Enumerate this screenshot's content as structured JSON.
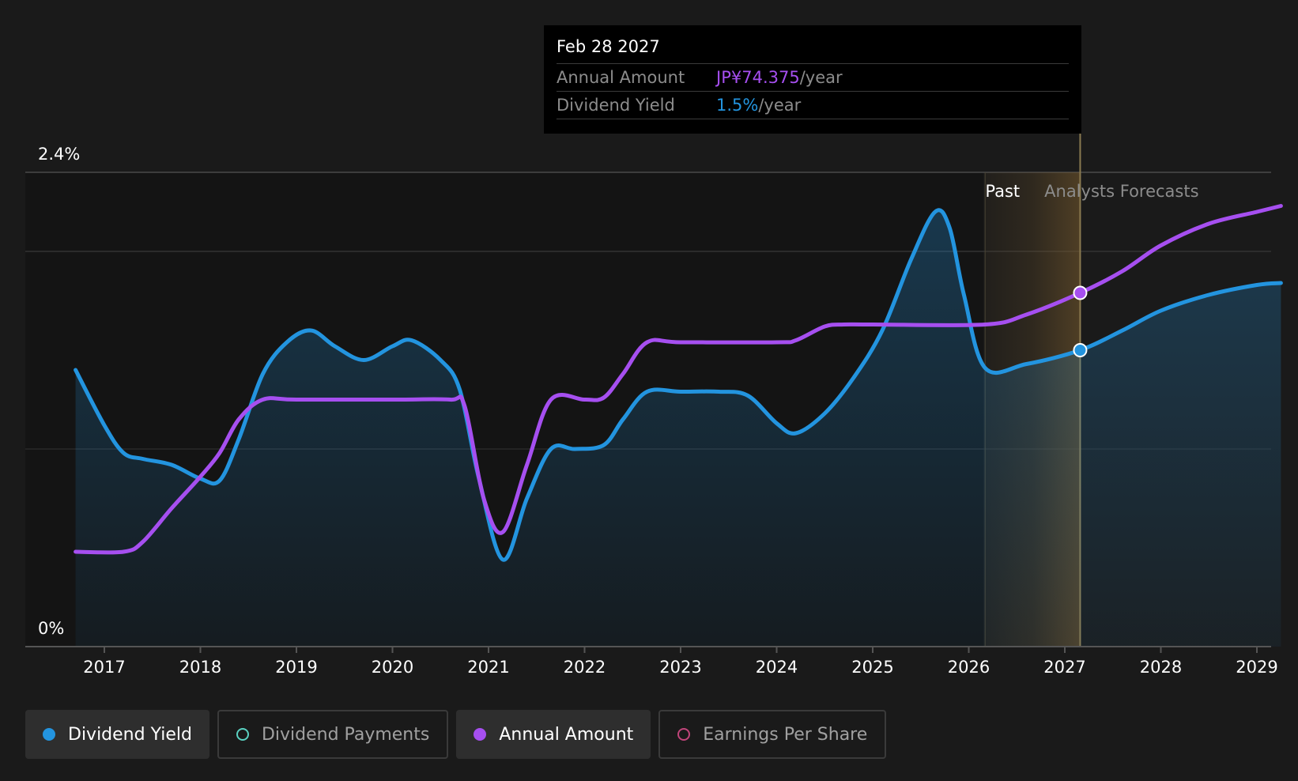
{
  "tooltip": {
    "date": "Feb 28 2027",
    "annual_label": "Annual Amount",
    "annual_value": "JP¥74.375",
    "annual_unit": "/year",
    "yield_label": "Dividend Yield",
    "yield_value": "1.5%",
    "yield_unit": "/year"
  },
  "colors": {
    "background": "#1a1a1a",
    "dividend_yield": "#2394df",
    "annual_amount": "#a64ff0",
    "dividend_payments": "#5ad1c1",
    "earnings_per_share": "#c0457a",
    "forecast_band": "#7a5c2e"
  },
  "legend": [
    {
      "label": "Dividend Yield",
      "icon": "filled-circle",
      "color": "#2394df",
      "active": true
    },
    {
      "label": "Dividend Payments",
      "icon": "hollow-circle",
      "color": "#5ad1c1",
      "active": false
    },
    {
      "label": "Annual Amount",
      "icon": "filled-circle",
      "color": "#a64ff0",
      "active": true
    },
    {
      "label": "Earnings Per Share",
      "icon": "hollow-circle",
      "color": "#c0457a",
      "active": false
    }
  ],
  "chart_data": {
    "type": "line",
    "y_tick_labels": [
      "2.4%",
      "0%"
    ],
    "ylim": [
      0,
      2.4
    ],
    "xlim": [
      2016.25,
      2029.25
    ],
    "x_tick_labels": [
      "2017",
      "2018",
      "2019",
      "2020",
      "2021",
      "2022",
      "2023",
      "2024",
      "2025",
      "2026",
      "2027",
      "2028",
      "2029"
    ],
    "past_label": "Past",
    "forecast_label": "Analysts Forecasts",
    "past_end": 2026.17,
    "hover_x": 2027.16,
    "grid": true,
    "series": [
      {
        "name": "Dividend Yield",
        "color": "#2394df",
        "fill": true,
        "points": [
          [
            2016.7,
            1.4
          ],
          [
            2017.0,
            1.12
          ],
          [
            2017.2,
            0.98
          ],
          [
            2017.4,
            0.95
          ],
          [
            2017.7,
            0.92
          ],
          [
            2018.0,
            0.85
          ],
          [
            2018.2,
            0.84
          ],
          [
            2018.4,
            1.05
          ],
          [
            2018.65,
            1.38
          ],
          [
            2018.9,
            1.54
          ],
          [
            2019.15,
            1.6
          ],
          [
            2019.4,
            1.52
          ],
          [
            2019.7,
            1.45
          ],
          [
            2020.0,
            1.52
          ],
          [
            2020.2,
            1.55
          ],
          [
            2020.5,
            1.45
          ],
          [
            2020.7,
            1.3
          ],
          [
            2020.9,
            0.85
          ],
          [
            2021.15,
            0.44
          ],
          [
            2021.4,
            0.75
          ],
          [
            2021.65,
            1.0
          ],
          [
            2021.9,
            1.0
          ],
          [
            2022.2,
            1.02
          ],
          [
            2022.4,
            1.15
          ],
          [
            2022.65,
            1.29
          ],
          [
            2023.0,
            1.29
          ],
          [
            2023.4,
            1.29
          ],
          [
            2023.7,
            1.27
          ],
          [
            2024.0,
            1.13
          ],
          [
            2024.2,
            1.08
          ],
          [
            2024.5,
            1.18
          ],
          [
            2024.8,
            1.36
          ],
          [
            2025.1,
            1.6
          ],
          [
            2025.4,
            1.96
          ],
          [
            2025.65,
            2.2
          ],
          [
            2025.8,
            2.12
          ],
          [
            2025.95,
            1.78
          ],
          [
            2026.17,
            1.41
          ],
          [
            2026.6,
            1.43
          ],
          [
            2027.16,
            1.5
          ],
          [
            2027.6,
            1.6
          ],
          [
            2028.0,
            1.7
          ],
          [
            2028.5,
            1.78
          ],
          [
            2029.0,
            1.83
          ],
          [
            2029.25,
            1.84
          ]
        ]
      },
      {
        "name": "Annual Amount",
        "color": "#a64ff0",
        "fill": false,
        "points": [
          [
            2016.7,
            0.48
          ],
          [
            2017.2,
            0.48
          ],
          [
            2017.4,
            0.53
          ],
          [
            2017.7,
            0.7
          ],
          [
            2018.0,
            0.86
          ],
          [
            2018.2,
            0.98
          ],
          [
            2018.4,
            1.15
          ],
          [
            2018.65,
            1.25
          ],
          [
            2019.0,
            1.25
          ],
          [
            2020.0,
            1.25
          ],
          [
            2020.6,
            1.25
          ],
          [
            2020.75,
            1.22
          ],
          [
            2020.95,
            0.75
          ],
          [
            2021.15,
            0.58
          ],
          [
            2021.4,
            0.92
          ],
          [
            2021.65,
            1.25
          ],
          [
            2022.0,
            1.25
          ],
          [
            2022.2,
            1.26
          ],
          [
            2022.4,
            1.38
          ],
          [
            2022.65,
            1.54
          ],
          [
            2023.0,
            1.54
          ],
          [
            2024.0,
            1.54
          ],
          [
            2024.2,
            1.55
          ],
          [
            2024.5,
            1.62
          ],
          [
            2024.7,
            1.63
          ],
          [
            2025.0,
            1.63
          ],
          [
            2026.17,
            1.63
          ],
          [
            2026.6,
            1.68
          ],
          [
            2027.16,
            1.79
          ],
          [
            2027.6,
            1.9
          ],
          [
            2028.0,
            2.03
          ],
          [
            2028.5,
            2.14
          ],
          [
            2029.0,
            2.2
          ],
          [
            2029.25,
            2.23
          ]
        ]
      }
    ]
  }
}
